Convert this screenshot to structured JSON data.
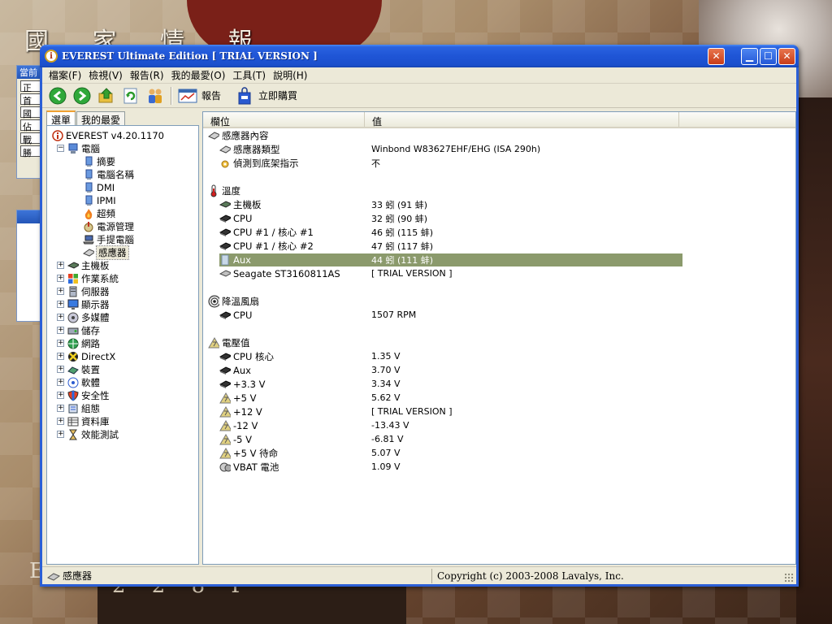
{
  "desktop": {
    "title": "國 家 情 報",
    "bottom_text": "2 2 8 P",
    "bottom_letter": "E",
    "panel1": {
      "header": "當前",
      "buttons": [
        "正",
        "首",
        "國",
        "佔",
        "戰",
        "勝"
      ]
    },
    "panel2": {
      "header": ""
    }
  },
  "window": {
    "title": "EVEREST Ultimate Edition  [ TRIAL VERSION ]",
    "app_icon": "i"
  },
  "menu": [
    "檔案(F)",
    "檢視(V)",
    "報告(R)",
    "我的最愛(O)",
    "工具(T)",
    "說明(H)"
  ],
  "toolbar": {
    "report_label": "報告",
    "buy_label": "立即購買"
  },
  "tabs": [
    "選單",
    "我的最愛"
  ],
  "tree": {
    "root": "EVEREST v4.20.1170",
    "computer": "電腦",
    "computer_children": [
      "摘要",
      "電腦名稱",
      "DMI",
      "IPMI",
      "超頻",
      "電源管理",
      "手提電腦",
      "感應器"
    ],
    "categories": [
      "主機板",
      "作業系統",
      "伺服器",
      "顯示器",
      "多媒體",
      "儲存",
      "網路",
      "DirectX",
      "裝置",
      "軟體",
      "安全性",
      "組態",
      "資料庫",
      "效能測試"
    ]
  },
  "columns": {
    "field": "欄位",
    "value": "值"
  },
  "sections": {
    "sensor": {
      "title": "感應器內容",
      "rows": [
        {
          "field": "感應器類型",
          "value": "Winbond W83627EHF/EHG  (ISA 290h)"
        },
        {
          "field": "偵測到底架指示",
          "value": "不"
        }
      ]
    },
    "temperature": {
      "title": "溫度",
      "rows": [
        {
          "field": "主機板",
          "value": "33 蚓  (91 蚌)"
        },
        {
          "field": "CPU",
          "value": "32 蚓  (90 蚌)"
        },
        {
          "field": "CPU #1 / 核心 #1",
          "value": "46 蚓  (115 蚌)"
        },
        {
          "field": "CPU #1 / 核心 #2",
          "value": "47 蚓  (117 蚌)"
        },
        {
          "field": "Aux",
          "value": "44 蚓  (111 蚌)"
        },
        {
          "field": "Seagate ST3160811AS",
          "value": "[ TRIAL VERSION ]"
        }
      ]
    },
    "fan": {
      "title": "降溫風扇",
      "rows": [
        {
          "field": "CPU",
          "value": "1507 RPM"
        }
      ]
    },
    "voltage": {
      "title": "電壓值",
      "rows": [
        {
          "field": "CPU 核心",
          "value": "1.35 V"
        },
        {
          "field": "Aux",
          "value": "3.70 V"
        },
        {
          "field": "+3.3 V",
          "value": "3.34 V"
        },
        {
          "field": "+5 V",
          "value": "5.62 V"
        },
        {
          "field": "+12 V",
          "value": "[ TRIAL VERSION ]"
        },
        {
          "field": "-12 V",
          "value": "-13.43 V"
        },
        {
          "field": "-5 V",
          "value": "-6.81 V"
        },
        {
          "field": "+5 V 待命",
          "value": "5.07 V"
        },
        {
          "field": "VBAT 電池",
          "value": "1.09 V"
        }
      ]
    }
  },
  "status": {
    "left": "感應器",
    "right": "Copyright (c) 2003-2008 Lavalys, Inc."
  },
  "colors": {
    "titlebar": "#1f55d6",
    "highlight": "#8b9a6c",
    "window_bg": "#ece9d8"
  }
}
